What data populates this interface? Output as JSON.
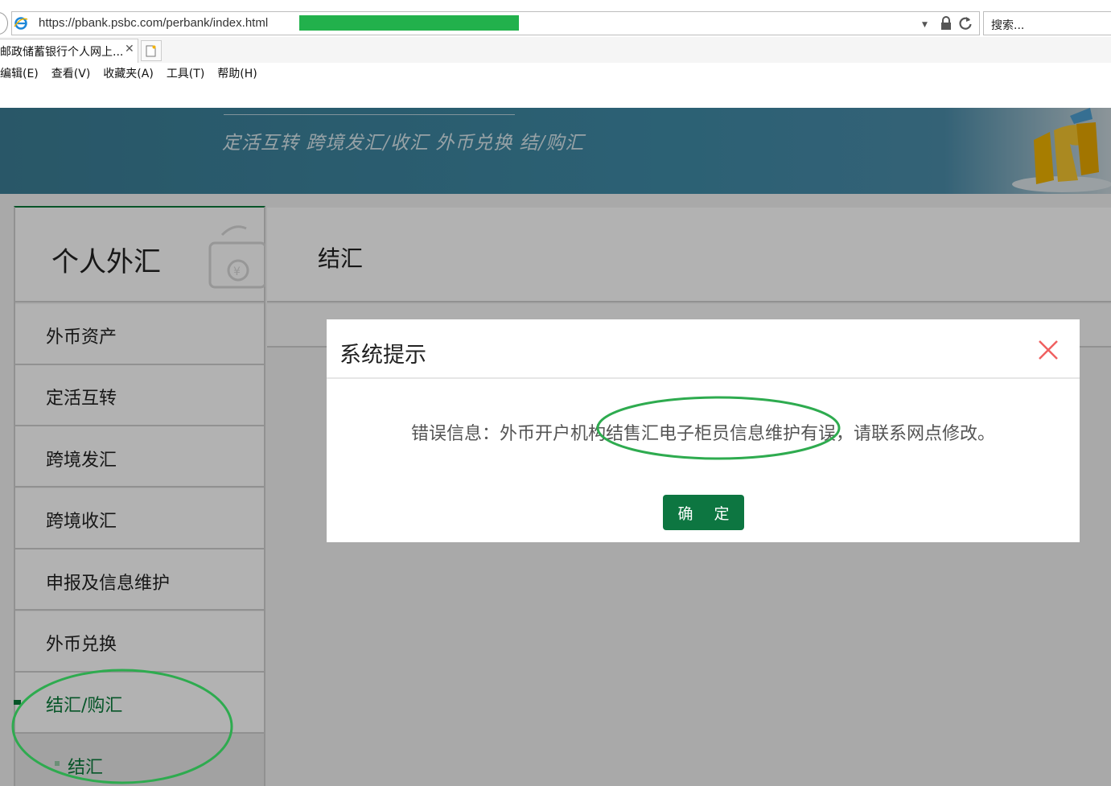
{
  "browser": {
    "url": "https://pbank.psbc.com/perbank/index.html",
    "search_placeholder": "搜索...",
    "tab_title": "邮政储蓄银行个人网上...",
    "tab_close": "✕",
    "menu": [
      "编辑(E)",
      "查看(V)",
      "收藏夹(A)",
      "工具(T)",
      "帮助(H)"
    ]
  },
  "banner": {
    "slogan": "定活互转 跨境发汇/收汇 外币兑换 结/购汇"
  },
  "sidebar": {
    "title": "个人外汇",
    "items": [
      {
        "label": "外币资产"
      },
      {
        "label": "定活互转"
      },
      {
        "label": "跨境发汇"
      },
      {
        "label": "跨境收汇"
      },
      {
        "label": "申报及信息维护"
      },
      {
        "label": "外币兑换"
      },
      {
        "label": "结汇/购汇"
      }
    ],
    "sub_item": "结汇"
  },
  "main": {
    "title": "结汇"
  },
  "dialog": {
    "title": "系统提示",
    "message": "错误信息：外币开户机构结售汇电子柜员信息维护有误，请联系网点修改。",
    "ok_label": "确 定"
  },
  "colors": {
    "brand_green": "#0d7641",
    "annotation_green": "#2eab4f",
    "banner_blue": "#3f8ba7",
    "close_red": "#f06060"
  },
  "icons": [
    "ie-icon",
    "lock-icon",
    "refresh-icon",
    "close-icon",
    "wallet-icon",
    "new-tab-icon"
  ]
}
